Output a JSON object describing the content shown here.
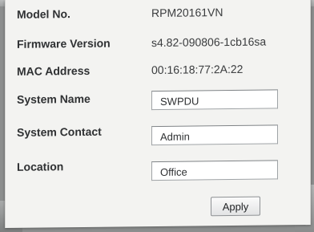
{
  "system_info": {
    "rows": [
      {
        "label": "Model No.",
        "value": "RPM20161VN"
      },
      {
        "label": "Firmware Version",
        "value": "s4.82-090806-1cb16sa"
      },
      {
        "label": "MAC Address",
        "value": "00:16:18:77:2A:22"
      }
    ]
  },
  "form": {
    "system_name": {
      "label": "System Name",
      "value": "SWPDU"
    },
    "system_contact": {
      "label": "System Contact",
      "value": "Admin"
    },
    "location": {
      "label": "Location",
      "value": "Office"
    },
    "apply_label": "Apply"
  },
  "colors": {
    "panel_background": "#f3f3f1",
    "label_text": "#2f3133",
    "input_border": "#9fa3a6"
  }
}
